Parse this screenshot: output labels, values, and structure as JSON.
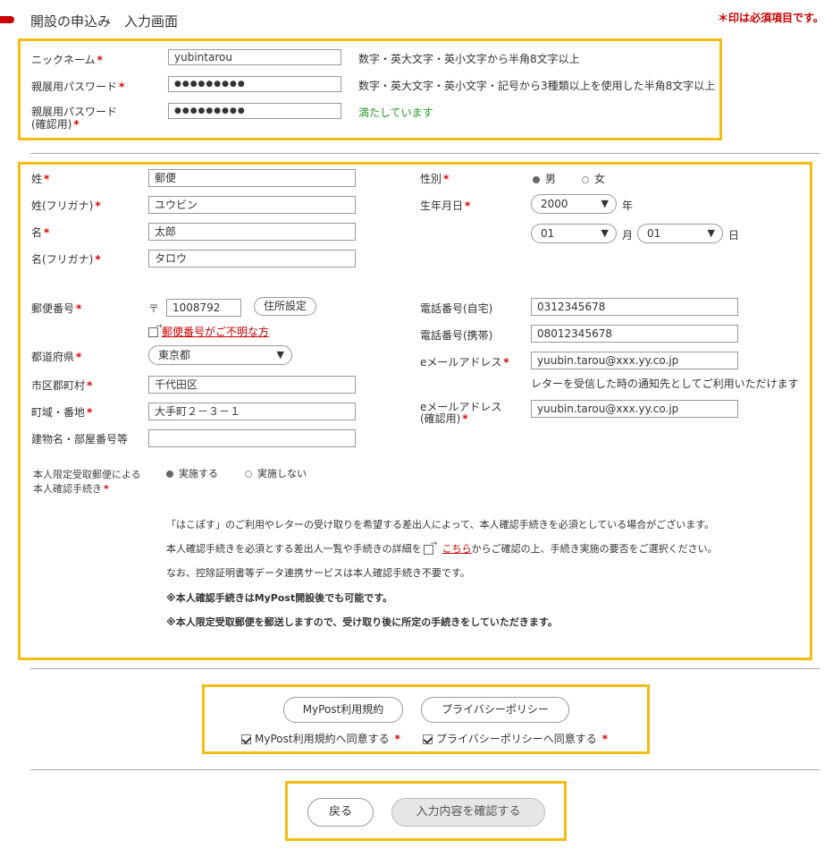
{
  "header": {
    "title": "開設の申込み　入力画面",
    "required_note": "＊印は必須項目です。"
  },
  "account": {
    "nickname_label": "ニックネーム",
    "nickname_value": "yubintarou",
    "nickname_hint": "数字・英大文字・英小文字から半角8文字以上",
    "password_label": "親展用パスワード",
    "password_value": "●●●●●●●●●",
    "password_hint": "数字・英大文字・英小文字・記号から3種類以上を使用した半角8文字以上",
    "password_confirm_label_1": "親展用パスワード",
    "password_confirm_label_2": "(確認用)",
    "password_confirm_value": "●●●●●●●●●",
    "password_confirm_status": "満たしています"
  },
  "personal": {
    "sei_label": "姓",
    "sei_value": "郵便",
    "sei_kana_label": "姓(フリガナ)",
    "sei_kana_value": "ユウビン",
    "mei_label": "名",
    "mei_value": "太郎",
    "mei_kana_label": "名(フリガナ)",
    "mei_kana_value": "タロウ",
    "gender_label": "性別",
    "gender_male": "男",
    "gender_female": "女",
    "birth_label": "生年月日",
    "birth_year": "2000",
    "year_unit": "年",
    "birth_month": "01",
    "month_unit": "月",
    "birth_day": "01",
    "day_unit": "日"
  },
  "address": {
    "postal_label": "郵便番号",
    "postal_mark": "〒",
    "postal_value": "1008792",
    "address_set_button": "住所設定",
    "postal_unknown_link": "郵便番号がご不明な方",
    "pref_label": "都道府県",
    "pref_value": "東京都",
    "city_label": "市区郡町村",
    "city_value": "千代田区",
    "town_label": "町域・番地",
    "town_value": "大手町２－３－１",
    "building_label": "建物名・部屋番号等",
    "building_value": ""
  },
  "contact": {
    "home_phone_label": "電話番号(自宅)",
    "home_phone_value": "0312345678",
    "mobile_phone_label": "電話番号(携帯)",
    "mobile_phone_value": "08012345678",
    "email_label": "eメールアドレス",
    "email_value": "yuubin.tarou@xxx.yy.co.jp",
    "email_hint": "レターを受信した時の通知先としてご利用いただけます",
    "email_confirm_label_1": "eメールアドレス",
    "email_confirm_label_2": "(確認用)",
    "email_confirm_value": "yuubin.tarou@xxx.yy.co.jp"
  },
  "identity": {
    "label_1": "本人限定受取郵便による",
    "label_2": "本人確認手続き",
    "option_yes": "実施する",
    "option_no": "実施しない",
    "note_1": "「はこぽす」のご利用やレターの受け取りを希望する差出人によって、本人確認手続きを必須としている場合がございます。",
    "note_2_pre": "本人確認手続きを必須とする差出人一覧や手続きの詳細を",
    "note_2_link": "こちら",
    "note_2_post": "からご確認の上、手続き実施の要否をご選択ください。",
    "note_3": "なお、控除証明書等データ連携サービスは本人確認手続き不要です。",
    "note_4": "※本人確認手続きはMyPost開設後でも可能です。",
    "note_5": "※本人限定受取郵便を郵送しますので、受け取り後に所定の手続きをしていただきます。"
  },
  "agreements": {
    "terms_button": "MyPost利用規約",
    "privacy_button": "プライバシーポリシー",
    "terms_agree": "MyPost利用規約へ同意する",
    "privacy_agree": "プライバシーポリシーへ同意する"
  },
  "footer": {
    "back_button": "戻る",
    "confirm_button": "入力内容を確認する"
  },
  "colors": {
    "accent_red": "#cc0000",
    "highlight_yellow": "#f5bd14",
    "success_green": "#2a9a2a"
  }
}
